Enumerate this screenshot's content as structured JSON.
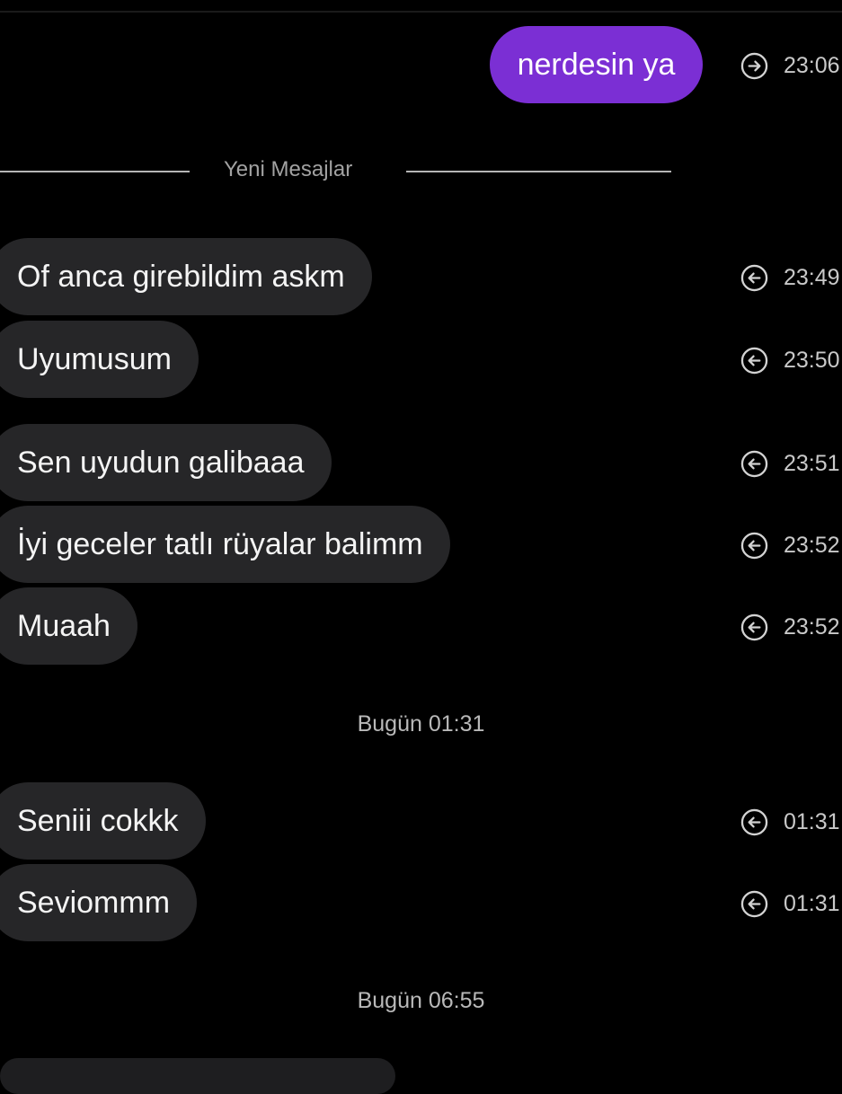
{
  "outgoing": [
    {
      "text": "nerdesin ya",
      "time": "23:06"
    }
  ],
  "new_messages_label": "Yeni Mesajlar",
  "incoming_group_1": [
    {
      "text": "Of anca girebildim askm",
      "time": "23:49"
    },
    {
      "text": "Uyumusum",
      "time": "23:50"
    },
    {
      "text": "Sen uyudun galibaaa",
      "time": "23:51"
    },
    {
      "text": "İyi geceler tatlı rüyalar balimm",
      "time": "23:52"
    },
    {
      "text": "Muaah",
      "time": "23:52"
    }
  ],
  "day_separator_1": "Bugün 01:31",
  "incoming_group_2": [
    {
      "text": "Seniii cokkk",
      "time": "01:31"
    },
    {
      "text": "Seviommm",
      "time": "01:31"
    }
  ],
  "day_separator_2": "Bugün 06:55",
  "colors": {
    "background": "#000000",
    "outgoing_bubble": "#7b2fd4",
    "incoming_bubble": "#262628"
  },
  "icons": {
    "sent": "arrow-right-circle-icon",
    "received": "arrow-left-circle-icon"
  }
}
